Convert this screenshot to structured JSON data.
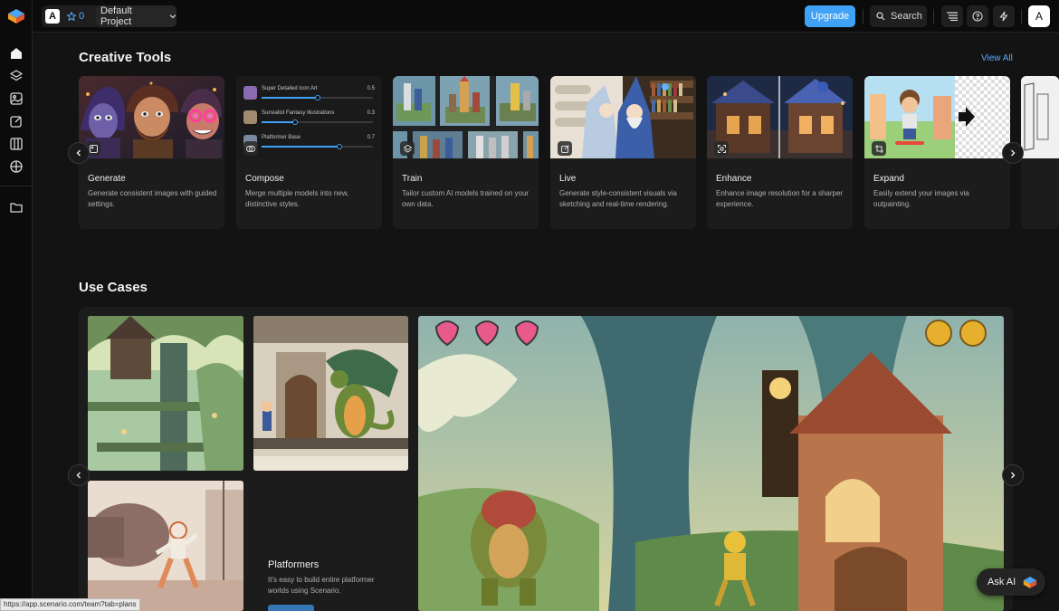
{
  "header": {
    "team_initial": "A",
    "star_count": "0",
    "project_name": "Default Project",
    "upgrade_label": "Upgrade",
    "search_label": "Search",
    "user_initial": "A"
  },
  "sidebar": {
    "items": [
      {
        "icon": "home-icon"
      },
      {
        "icon": "layers-icon"
      },
      {
        "icon": "image-icon"
      },
      {
        "icon": "edit-icon"
      },
      {
        "icon": "book-icon"
      },
      {
        "icon": "globe-icon"
      },
      {
        "icon": "folder-icon"
      }
    ]
  },
  "creative_tools": {
    "title": "Creative Tools",
    "view_all": "View All",
    "compose_models": [
      {
        "name": "Super Detailed Icon Art",
        "value": "0.5",
        "level": 0.5
      },
      {
        "name": "Surrealist Fantasy Illustrations",
        "value": "0.3",
        "level": 0.3
      },
      {
        "name": "Platformer Base",
        "value": "0.7",
        "level": 0.7
      }
    ],
    "tools": [
      {
        "name": "Generate",
        "description": "Generate consistent images with guided settings."
      },
      {
        "name": "Compose",
        "description": "Merge multiple models into new, distinctive styles."
      },
      {
        "name": "Train",
        "description": "Tailor custom AI models trained on your own data."
      },
      {
        "name": "Live",
        "description": "Generate style-consistent visuals via sketching and real-time rendering."
      },
      {
        "name": "Enhance",
        "description": "Enhance image resolution for a sharper experience."
      },
      {
        "name": "Expand",
        "description": "Easily extend your images via outpainting."
      }
    ]
  },
  "use_cases": {
    "title": "Use Cases",
    "featured_title": "Platformers",
    "featured_description": "It's easy to build entire platformer worlds using Scenario."
  },
  "status_url": "https://app.scenario.com/team?tab=plans",
  "ask_ai_label": "Ask AI",
  "colors": {
    "accent": "#3fa2f6",
    "link": "#5aa9ff",
    "background": "#131313",
    "card": "#1c1c1c"
  }
}
